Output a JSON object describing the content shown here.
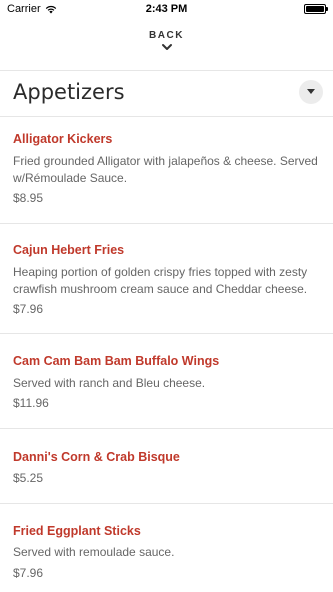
{
  "status": {
    "carrier": "Carrier",
    "time": "2:43 PM",
    "battery_level": 1.0
  },
  "nav": {
    "back_label": "BACK"
  },
  "section": {
    "title": "Appetizers"
  },
  "items": [
    {
      "name": "Alligator Kickers",
      "description": "Fried grounded Alligator with jalapeños & cheese. Served w/Rémoulade Sauce.",
      "price": "$8.95"
    },
    {
      "name": "Cajun Hebert Fries",
      "description": "Heaping portion of golden crispy fries topped with zesty crawfish mushroom cream sauce and Cheddar cheese.",
      "price": "$7.96"
    },
    {
      "name": "Cam Cam Bam Bam Buffalo Wings",
      "description": "Served with ranch and Bleu cheese.",
      "price": "$11.96"
    },
    {
      "name": "Danni's Corn & Crab Bisque",
      "description": "",
      "price": "$5.25"
    },
    {
      "name": "Fried Eggplant Sticks",
      "description": "Served with remoulade sauce.",
      "price": "$7.96"
    }
  ],
  "colors": {
    "accent": "#c0392b",
    "text_muted": "#666666",
    "divider": "#e6e6e6"
  }
}
